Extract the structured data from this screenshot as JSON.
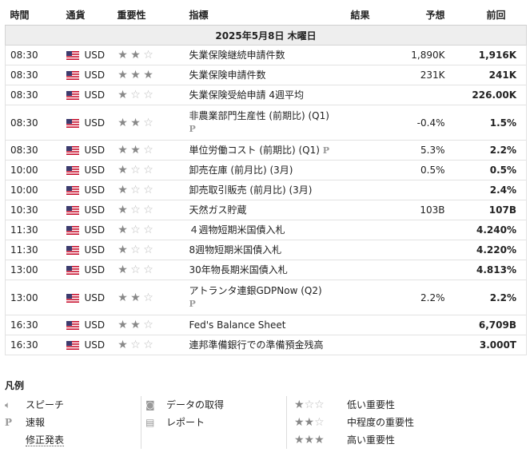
{
  "headers": {
    "time": "時間",
    "currency": "通貨",
    "importance": "重要性",
    "indicator": "指標",
    "result": "結果",
    "forecast": "予想",
    "previous": "前回"
  },
  "date_label": "2025年5月8日 木曜日",
  "events": [
    {
      "time": "08:30",
      "currency": "USD",
      "stars": 2,
      "name": "失業保険継続申請件数",
      "prelim": false,
      "forecast": "1,890K",
      "previous": "1,916K"
    },
    {
      "time": "08:30",
      "currency": "USD",
      "stars": 3,
      "name": "失業保険申請件数",
      "prelim": false,
      "forecast": "231K",
      "previous": "241K"
    },
    {
      "time": "08:30",
      "currency": "USD",
      "stars": 1,
      "name": "失業保険受給申請 4週平均",
      "prelim": false,
      "forecast": "",
      "previous": "226.00K"
    },
    {
      "time": "08:30",
      "currency": "USD",
      "stars": 2,
      "name": "非農業部門生産性 (前期比) (Q1)",
      "prelim": true,
      "prelim_wrap": true,
      "forecast": "-0.4%",
      "previous": "1.5%"
    },
    {
      "time": "08:30",
      "currency": "USD",
      "stars": 2,
      "name": "単位労働コスト (前期比) (Q1)",
      "prelim": true,
      "prelim_wrap": false,
      "forecast": "5.3%",
      "previous": "2.2%"
    },
    {
      "time": "10:00",
      "currency": "USD",
      "stars": 1,
      "name": "卸売在庫 (前月比) (3月)",
      "prelim": false,
      "forecast": "0.5%",
      "previous": "0.5%"
    },
    {
      "time": "10:00",
      "currency": "USD",
      "stars": 1,
      "name": "卸売取引販売 (前月比) (3月)",
      "prelim": false,
      "forecast": "",
      "previous": "2.4%"
    },
    {
      "time": "10:30",
      "currency": "USD",
      "stars": 1,
      "name": "天然ガス貯蔵",
      "prelim": false,
      "forecast": "103B",
      "previous": "107B"
    },
    {
      "time": "11:30",
      "currency": "USD",
      "stars": 1,
      "name": "４週物短期米国債入札",
      "prelim": false,
      "forecast": "",
      "previous": "4.240%"
    },
    {
      "time": "11:30",
      "currency": "USD",
      "stars": 1,
      "name": "8週物短期米国債入札",
      "prelim": false,
      "forecast": "",
      "previous": "4.220%"
    },
    {
      "time": "13:00",
      "currency": "USD",
      "stars": 1,
      "name": "30年物長期米国債入札",
      "prelim": false,
      "forecast": "",
      "previous": "4.813%"
    },
    {
      "time": "13:00",
      "currency": "USD",
      "stars": 2,
      "name": "アトランタ連銀GDPNow (Q2)",
      "prelim": true,
      "prelim_wrap": true,
      "forecast": "2.2%",
      "previous": "2.2%"
    },
    {
      "time": "16:30",
      "currency": "USD",
      "stars": 2,
      "name": "Fed's Balance Sheet",
      "prelim": false,
      "forecast": "",
      "previous": "6,709B"
    },
    {
      "time": "16:30",
      "currency": "USD",
      "stars": 1,
      "name": "連邦準備銀行での準備預金残高",
      "prelim": false,
      "forecast": "",
      "previous": "3.000T"
    }
  ],
  "legend": {
    "title": "凡例",
    "speech": "スピーチ",
    "prelim": "速報",
    "revised": "修正発表",
    "data_get": "データの取得",
    "report": "レポート",
    "low": "低い重要性",
    "mid": "中程度の重要性",
    "high": "高い重要性"
  },
  "colors": {
    "star_on": "#888888",
    "star_off": "#bbbbbb",
    "date_bg": "#eeeeee"
  }
}
